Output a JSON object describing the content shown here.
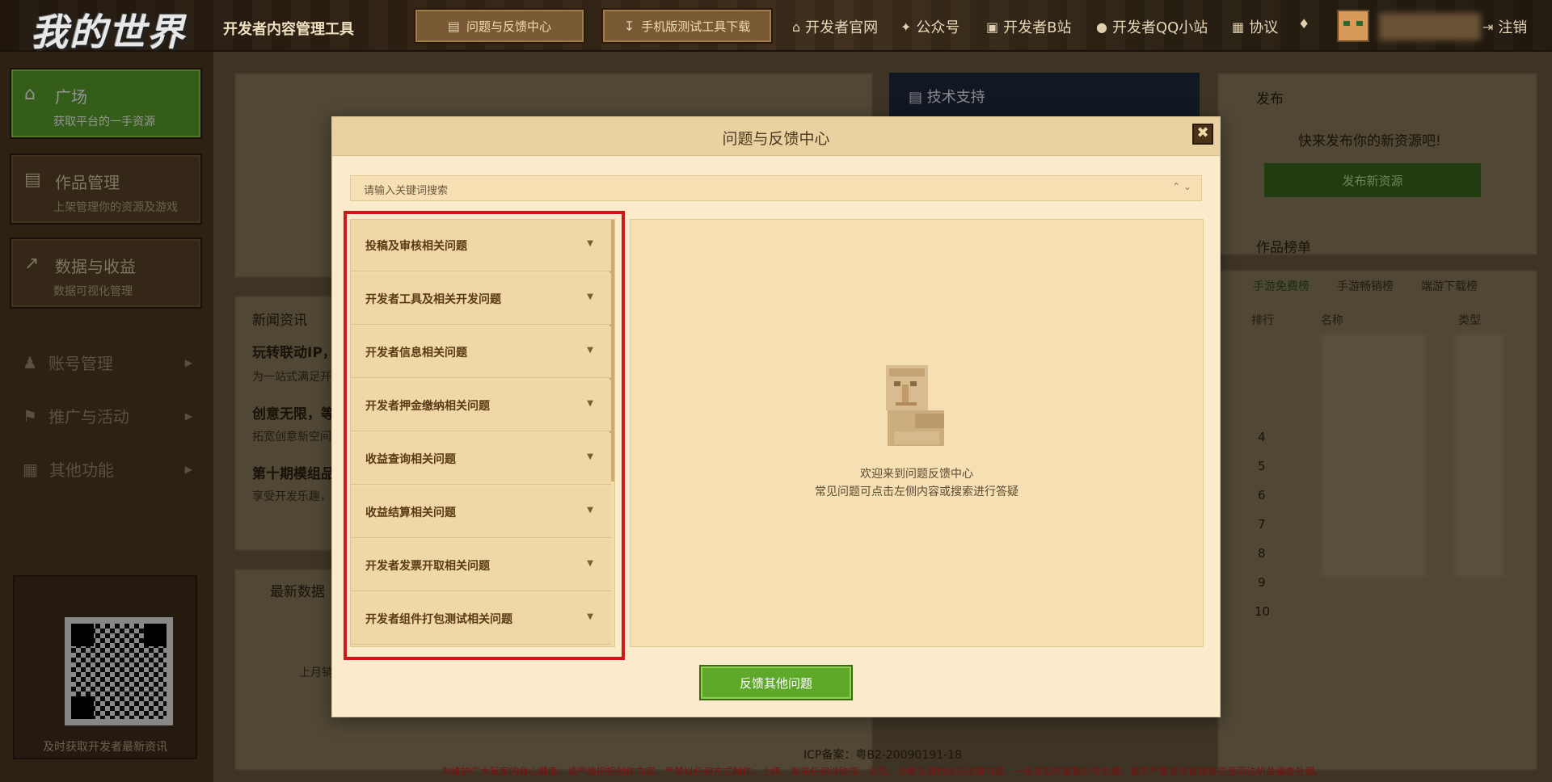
{
  "header": {
    "logo": "我的世界",
    "app_name": "开发者内容管理工具",
    "feedback_btn": "问题与反馈中心",
    "mobile_tool_btn": "手机版测试工具下载",
    "links": [
      "开发者官网",
      "公众号",
      "开发者B站",
      "开发者QQ小站",
      "协议"
    ],
    "logout": "注销"
  },
  "sidebar": {
    "cards": [
      {
        "title": "广场",
        "subtitle": "获取平台的一手资源",
        "active": true
      },
      {
        "title": "作品管理",
        "subtitle": "上架管理你的资源及游戏",
        "active": false
      },
      {
        "title": "数据与收益",
        "subtitle": "数据可视化管理",
        "active": false
      }
    ],
    "menu": [
      "账号管理",
      "推广与活动",
      "其他功能"
    ],
    "qr_caption": "及时获取开发者最新资讯"
  },
  "background": {
    "tech_support": "技术支持",
    "publish_title": "发布",
    "publish_desc": "快来发布你的新资源吧!",
    "publish_btn": "发布新资源",
    "ranking_title": "作品榜单",
    "ranking_tabs": [
      "手游免费榜",
      "手游畅销榜",
      "端游下载榜"
    ],
    "ranking_cols": [
      "排行",
      "名称",
      "类型"
    ],
    "ranks": [
      "4",
      "5",
      "6",
      "7",
      "8",
      "9",
      "10"
    ],
    "news_title": "新闻资讯",
    "news": [
      {
        "headline": "玩转联动IP，",
        "desc": "为一站式满足开"
      },
      {
        "headline": "创意无限，等",
        "desc": "拓宽创意新空间"
      },
      {
        "headline": "第十期模组品",
        "desc": "享受开发乐趣，"
      }
    ],
    "latest_data": "最新数据",
    "last_month": "上月销"
  },
  "modal": {
    "title": "问题与反馈中心",
    "search_placeholder": "请输入关键词搜索",
    "faq": [
      "投稿及审核相关问题",
      "开发者工具及相关开发问题",
      "开发者信息相关问题",
      "开发者押金缴纳相关问题",
      "收益查询相关问题",
      "收益结算相关问题",
      "开发者发票开取相关问题",
      "开发者组件打包测试相关问题"
    ],
    "welcome_line1": "欢迎来到问题反馈中心",
    "welcome_line2": "常见问题可点击左侧内容或搜索进行答疑",
    "feedback_other": "反馈其他问题"
  },
  "footer": {
    "icp": "ICP备案：粤B2-20090191-18",
    "warning": "为维护广大玩家的身心健康，请严格把控创作内容，严禁以任何方式制作、上传、发布任何涉敏感、涉恐、涉黄及其他违法违规内容。一经发现将直接封号处理，情节严重者将直接移交至司法机关调查处理。"
  },
  "colors": {
    "accent_green": "#5ea82a",
    "modal_bg": "#fbeacb",
    "highlight_red": "#cc1818"
  }
}
